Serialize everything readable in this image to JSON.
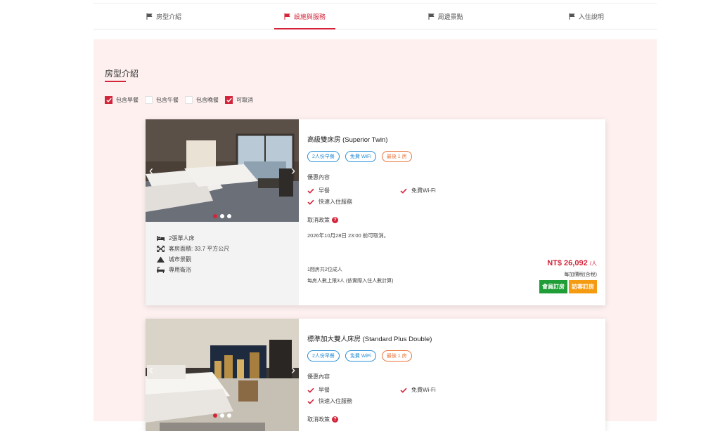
{
  "tabs": [
    {
      "label": "房型介紹",
      "active": false
    },
    {
      "label": "設施與服務",
      "active": true
    },
    {
      "label": "周邊景點",
      "active": false
    },
    {
      "label": "入住說明",
      "active": false
    }
  ],
  "section": {
    "title": "房型介紹"
  },
  "filters": [
    {
      "label": "包含早餐",
      "checked": true
    },
    {
      "label": "包含午餐",
      "checked": false
    },
    {
      "label": "包含晚餐",
      "checked": false
    },
    {
      "label": "可取消",
      "checked": true
    }
  ],
  "colors": {
    "accent": "#d3253a",
    "panel_bg": "#fdf0ef",
    "badge_blue": "#2b8fd6",
    "badge_orange": "#e8743b",
    "member_btn": "#1f9d36",
    "guest_btn": "#f59b11"
  },
  "rooms": [
    {
      "name": "高級雙床房 (Superior Twin)",
      "badges": [
        "2人份早餐",
        "免費 WiFi",
        "最後 1 房"
      ],
      "offer_title": "優惠內容",
      "perks": [
        "早餐",
        "免費Wi-Fi",
        "快速入住服務"
      ],
      "cancel_title": "取消政策",
      "cancel_text": "2026年10月28日 23:00 前可取消。",
      "occupancy": "1間房共2位成人",
      "max_guests": "每房人數上限3人 (依實際入住人數計算)",
      "price": "NT$ 26,092",
      "price_unit": "/人",
      "tax_note": "每加價稅(含稅)",
      "member_btn": "會員訂房",
      "guest_btn": "訪客訂房",
      "amenities": [
        {
          "icon": "bed-icon",
          "label": "2張單人床"
        },
        {
          "icon": "area-icon",
          "label": "客房面積: 33.7 平方公尺"
        },
        {
          "icon": "mountain-icon",
          "label": "城市景觀"
        },
        {
          "icon": "bath-icon",
          "label": "專用衛浴"
        }
      ]
    },
    {
      "name": "標準加大雙人床房 (Standard Plus Double)",
      "badges": [
        "2人份早餐",
        "免費 WiFi",
        "最後 1 房"
      ],
      "offer_title": "優惠內容",
      "perks": [
        "早餐",
        "免費Wi-Fi",
        "快速入住服務"
      ],
      "cancel_title": "取消政策"
    }
  ]
}
